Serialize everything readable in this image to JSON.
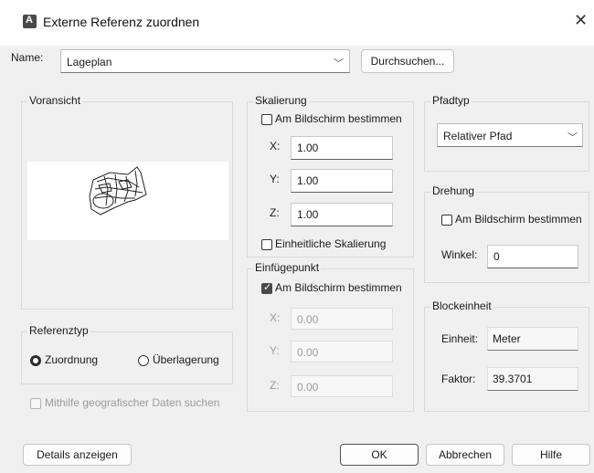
{
  "window": {
    "title": "Externe Referenz zuordnen",
    "app_icon": "autocad-icon",
    "close_glyph": "✕"
  },
  "name_row": {
    "label": "Name:",
    "value": "Lageplan",
    "browse_label": "Durchsuchen..."
  },
  "preview": {
    "title": "Voransicht"
  },
  "reference_type": {
    "title": "Referenztyp",
    "attach_label": "Zuordnung",
    "overlay_label": "Überlagerung",
    "selected": "Zuordnung"
  },
  "geo_search": {
    "label": "Mithilfe geografischer Daten suchen",
    "checked": false,
    "enabled": false
  },
  "scale": {
    "title": "Skalierung",
    "on_screen_label": "Am Bildschirm bestimmen",
    "on_screen_checked": false,
    "x_label": "X:",
    "x_value": "1.00",
    "y_label": "Y:",
    "y_value": "1.00",
    "z_label": "Z:",
    "z_value": "1.00",
    "uniform_label": "Einheitliche Skalierung",
    "uniform_checked": false
  },
  "insertion": {
    "title": "Einfügepunkt",
    "on_screen_label": "Am Bildschirm bestimmen",
    "on_screen_checked": true,
    "x_label": "X:",
    "x_value": "0.00",
    "y_label": "Y:",
    "y_value": "0.00",
    "z_label": "Z:",
    "z_value": "0.00"
  },
  "path_type": {
    "title": "Pfadtyp",
    "value": "Relativer Pfad"
  },
  "rotation": {
    "title": "Drehung",
    "on_screen_label": "Am Bildschirm bestimmen",
    "on_screen_checked": false,
    "angle_label": "Winkel:",
    "angle_value": "0"
  },
  "block_unit": {
    "title": "Blockeinheit",
    "unit_label": "Einheit:",
    "unit_value": "Meter",
    "factor_label": "Faktor:",
    "factor_value": "39.3701"
  },
  "footer": {
    "details_label": "Details anzeigen",
    "ok_label": "OK",
    "cancel_label": "Abbrechen",
    "help_label": "Hilfe"
  }
}
